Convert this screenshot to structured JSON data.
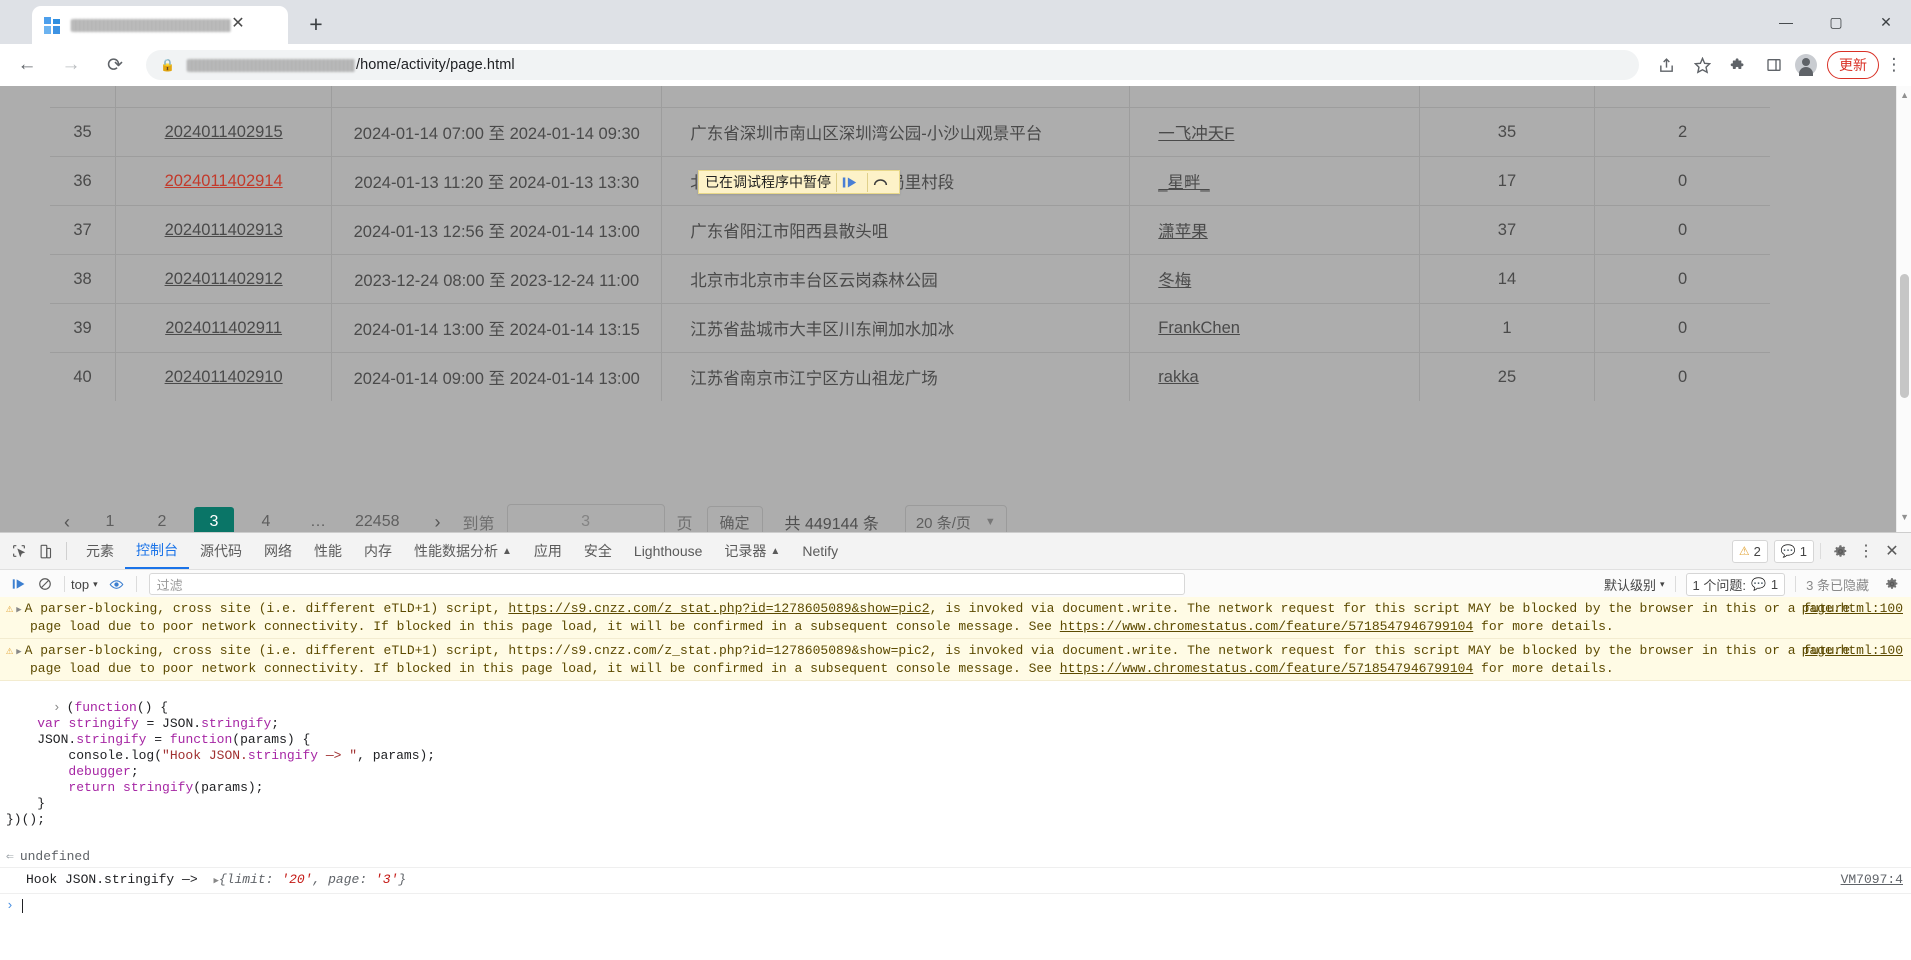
{
  "browser": {
    "tab_title_redacted": true,
    "url_prefix_redacted": true,
    "url_text": "/home/activity/page.html",
    "lock_icon": "lock-icon",
    "back_icon": "←",
    "forward_icon": "→",
    "reload_icon": "⟳",
    "share_icon": "share-icon",
    "bookmark_icon": "★",
    "extensions_icon": "puzzle-icon",
    "sidepanel_icon": "side-panel-icon",
    "new_tab_icon": "+",
    "close_tab_icon": "✕",
    "update_label": "更新",
    "kebab_icon": "⋮",
    "minimize_icon": "—",
    "maximize_icon": "▢",
    "window_close_icon": "✕"
  },
  "paused_banner": {
    "text": "已在调试程序中暂停",
    "resume_icon": "resume-script-icon",
    "step_over_icon": "step-over-icon"
  },
  "table": {
    "rows": [
      {
        "idx": "35",
        "id": "2024011402915",
        "visited": false,
        "time": "2024-01-14 07:00 至 2024-01-14 09:30",
        "location": "广东省深圳市南山区深圳湾公园-小沙山观景平台",
        "user": "一飞冲天F",
        "count": "35",
        "extra": "2"
      },
      {
        "idx": "36",
        "id": "2024011402914",
        "visited": true,
        "time": "2024-01-13 11:20 至 2024-01-13 13:30",
        "location": "北京市北京市怀柔区怀九河局里村段",
        "user": "_星畔_",
        "count": "17",
        "extra": "0"
      },
      {
        "idx": "37",
        "id": "2024011402913",
        "visited": false,
        "time": "2024-01-13 12:56 至 2024-01-14 13:00",
        "location": "广东省阳江市阳西县散头咀",
        "user": "潇苹果",
        "count": "37",
        "extra": "0"
      },
      {
        "idx": "38",
        "id": "2024011402912",
        "visited": false,
        "time": "2023-12-24 08:00 至 2023-12-24 11:00",
        "location": "北京市北京市丰台区云岗森林公园",
        "user": "冬梅",
        "count": "14",
        "extra": "0"
      },
      {
        "idx": "39",
        "id": "2024011402911",
        "visited": false,
        "time": "2024-01-14 13:00 至 2024-01-14 13:15",
        "location": "江苏省盐城市大丰区川东闸加水加冰",
        "user": "FrankChen",
        "count": "1",
        "extra": "0"
      },
      {
        "idx": "40",
        "id": "2024011402910",
        "visited": false,
        "time": "2024-01-14 09:00 至 2024-01-14 13:00",
        "location": "江苏省南京市江宁区方山祖龙广场",
        "user": "rakka",
        "count": "25",
        "extra": "0"
      }
    ]
  },
  "pagination": {
    "prev_icon": "‹",
    "next_icon": "›",
    "pages": [
      "1",
      "2",
      "3",
      "4",
      "…",
      "22458"
    ],
    "active_page": "3",
    "active_color": "#0a7567",
    "jump_prefix": "到第",
    "jump_value": "3",
    "jump_suffix": "页",
    "confirm_label": "确定",
    "total_label": "共 449144 条",
    "per_page_label": "20 条/页",
    "per_page_chevron": "chevron-down-icon"
  },
  "devtools": {
    "inspect_icon": "inspect-element-icon",
    "device_icon": "device-toolbar-icon",
    "tabs": [
      {
        "label": "元素",
        "active": false,
        "exp": ""
      },
      {
        "label": "控制台",
        "active": true,
        "exp": ""
      },
      {
        "label": "源代码",
        "active": false,
        "exp": ""
      },
      {
        "label": "网络",
        "active": false,
        "exp": ""
      },
      {
        "label": "性能",
        "active": false,
        "exp": ""
      },
      {
        "label": "内存",
        "active": false,
        "exp": ""
      },
      {
        "label": "性能数据分析",
        "active": false,
        "exp": "▲"
      },
      {
        "label": "应用",
        "active": false,
        "exp": ""
      },
      {
        "label": "安全",
        "active": false,
        "exp": ""
      },
      {
        "label": "Lighthouse",
        "active": false,
        "exp": ""
      },
      {
        "label": "记录器",
        "active": false,
        "exp": "▲"
      },
      {
        "label": "Netify",
        "active": false,
        "exp": ""
      }
    ],
    "warn_count": "2",
    "info_count": "1",
    "settings_icon": "gear-icon",
    "more_icon": "⋮",
    "close_icon": "✕",
    "execute_icon": "execute-snippet-icon",
    "clear_icon": "clear-console-icon",
    "context_label": "top",
    "context_chevron": "▾",
    "eye_icon": "live-expression-icon",
    "filter_placeholder": "过滤",
    "level_label": "默认级别",
    "level_chevron": "▾",
    "issues_label": "1 个问题:",
    "issues_count": "1",
    "hidden_label": "3 条已隐藏",
    "console_gear_icon": "gear-icon"
  },
  "console": {
    "warnings": [
      {
        "pre": "A parser-blocking, cross site (i.e. different eTLD+1) script, ",
        "link": "https://s9.cnzz.com/z_stat.php?id=1278605089&show=pic2",
        "mid": ", is invoked via document.write. The network request for this script MAY be blocked by the browser in this or a future page load due to poor network connectivity. If blocked in this page load, it will be confirmed in a subsequent console message. See ",
        "link2": "https://www.chromestatus.com/feature/5718547946799104",
        "post": " for more details.",
        "source": "page.html:100"
      },
      {
        "pre": "A parser-blocking, cross site (i.e. different eTLD+1) script, ",
        "link": "https://s9.cnzz.com/z_stat.php?id=1278605089&show=pic2",
        "mid": ", is invoked via document.write. The network request for this script MAY be blocked by the browser in this or a future page load due to poor network connectivity. If blocked in this page load, it will be confirmed in a subsequent console message. See ",
        "link2": "https://www.chromestatus.com/feature/5718547946799104",
        "post": " for more details.",
        "source": "page.html:100"
      }
    ],
    "snippet_lines": [
      "(function() {",
      "    var stringify = JSON.stringify;",
      "    JSON.stringify = function(params) {",
      "        console.log(\"Hook JSON.stringify —> \", params);",
      "        debugger;",
      "        return stringify(params);",
      "    }",
      "})();"
    ],
    "result": "undefined",
    "log_label": "Hook JSON.stringify —> ",
    "log_object": "{limit: '20', page: '3'}",
    "log_obj_prefix": "{",
    "log_obj_k1": "limit: ",
    "log_obj_v1": "'20'",
    "log_obj_sep": ", ",
    "log_obj_k2": "page: ",
    "log_obj_v2": "'3'",
    "log_obj_suffix": "}",
    "log_source": "VM7097:4",
    "prompt": "›"
  }
}
